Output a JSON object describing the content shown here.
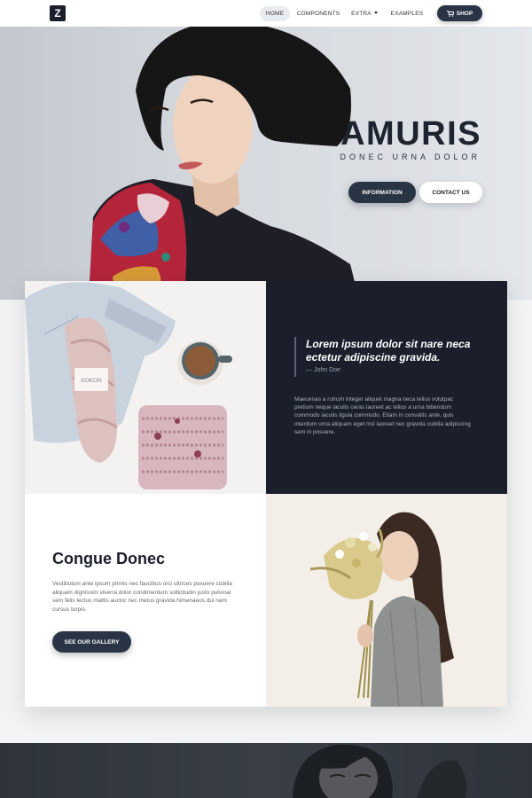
{
  "nav": {
    "logo": "Z",
    "items": [
      "HOME",
      "COMPONENTS",
      "EXTRA",
      "EXAMPLES"
    ],
    "shop_label": "SHOP"
  },
  "hero": {
    "title": "AMURIS",
    "subtitle": "DONEC URNA DOLOR",
    "button_primary": "INFORMATION",
    "button_secondary": "CONTACT US"
  },
  "quote": {
    "text": "Lorem ipsum dolor sit nare neca ectetur adipiscine gravida.",
    "author": "— John Doe",
    "body": "Maecenas a rutrum integer aliquet magna neca tellus volutpac pretium neque iaculis ceras laoreet ac tellus a urna bibendum commodo iaculis ligula commodo. Etiam in convallis ante, quis interdum urna aliquam eget nisl laoreet nec gravida cubilia adipiscing sem in posuere."
  },
  "feature": {
    "title": "Congue Donec",
    "body": "Vestibulum ante ipsum primis nec faucibus orci ultrices posuere cubilia aliquam dignissim viverra dolor condimentum sollicitudin justo pulvinar sem felis lectus mattis auctor nec metus gravida himenaeos dui nam cursus turpis.",
    "button": "SEE OUR GALLERY"
  },
  "yarn_tag": "KOKON",
  "colors": {
    "dark": "#1a1f2b",
    "button": "#293445",
    "hero_bg": "#d5d9de",
    "accent_red": "#c4233a"
  }
}
